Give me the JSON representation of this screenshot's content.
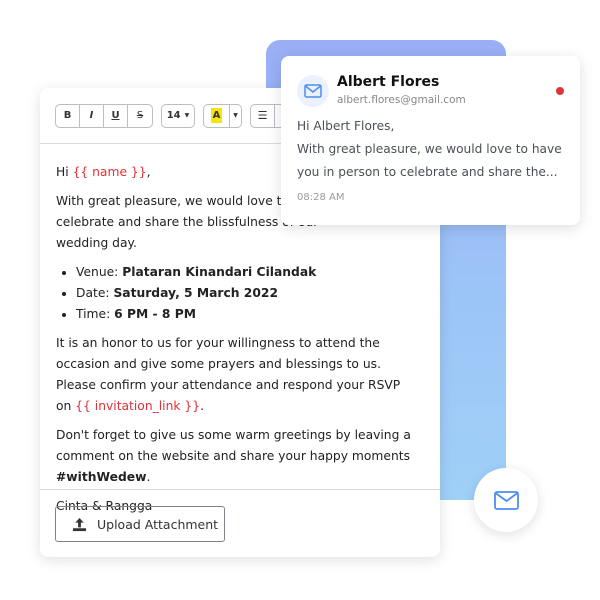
{
  "toolbar": {
    "bold": "B",
    "italic": "I",
    "underline": "U",
    "strike": "S",
    "font_size": "14",
    "highlight": "A",
    "accent_highlight": "#f5e50a"
  },
  "editor": {
    "greeting_prefix": "Hi ",
    "greeting_var": "{{ name }}",
    "greeting_suffix": ",",
    "para1_lines": [
      "With great pleasure, we would love to have",
      "celebrate and share the blissfulness of our",
      "wedding day."
    ],
    "bullets": [
      {
        "label": "Venue: ",
        "value": "Plataran Kinandari Cilandak"
      },
      {
        "label": "Date: ",
        "value": "Saturday, 5 March 2022"
      },
      {
        "label": "Time: ",
        "value": "6 PM - 8 PM"
      }
    ],
    "para2": "It is an honor to us for your willingness to attend the occasion and give some prayers and blessings to us. Please confirm your attendance and respond your RSVP on ",
    "para2_var": "{{ invitation_link }}",
    "para2_end": ".",
    "para3": "Don't forget to give us some warm greetings by leaving a comment on the website and share your happy moments ",
    "para3_tag": "#withWedew",
    "para3_end": ".",
    "signature": "Cinta & Rangga",
    "upload_label": "Upload Attachment"
  },
  "notification": {
    "name": "Albert Flores",
    "email": "albert.flores@gmail.com",
    "line1": "Hi Albert Flores,",
    "line2": "With great pleasure, we would love to have",
    "line3": "you in person to celebrate and share the...",
    "time": "08:28 AM",
    "unread_color": "#e0323a"
  },
  "colors": {
    "accent": "#4a8ef0",
    "variable": "#e0323a"
  }
}
